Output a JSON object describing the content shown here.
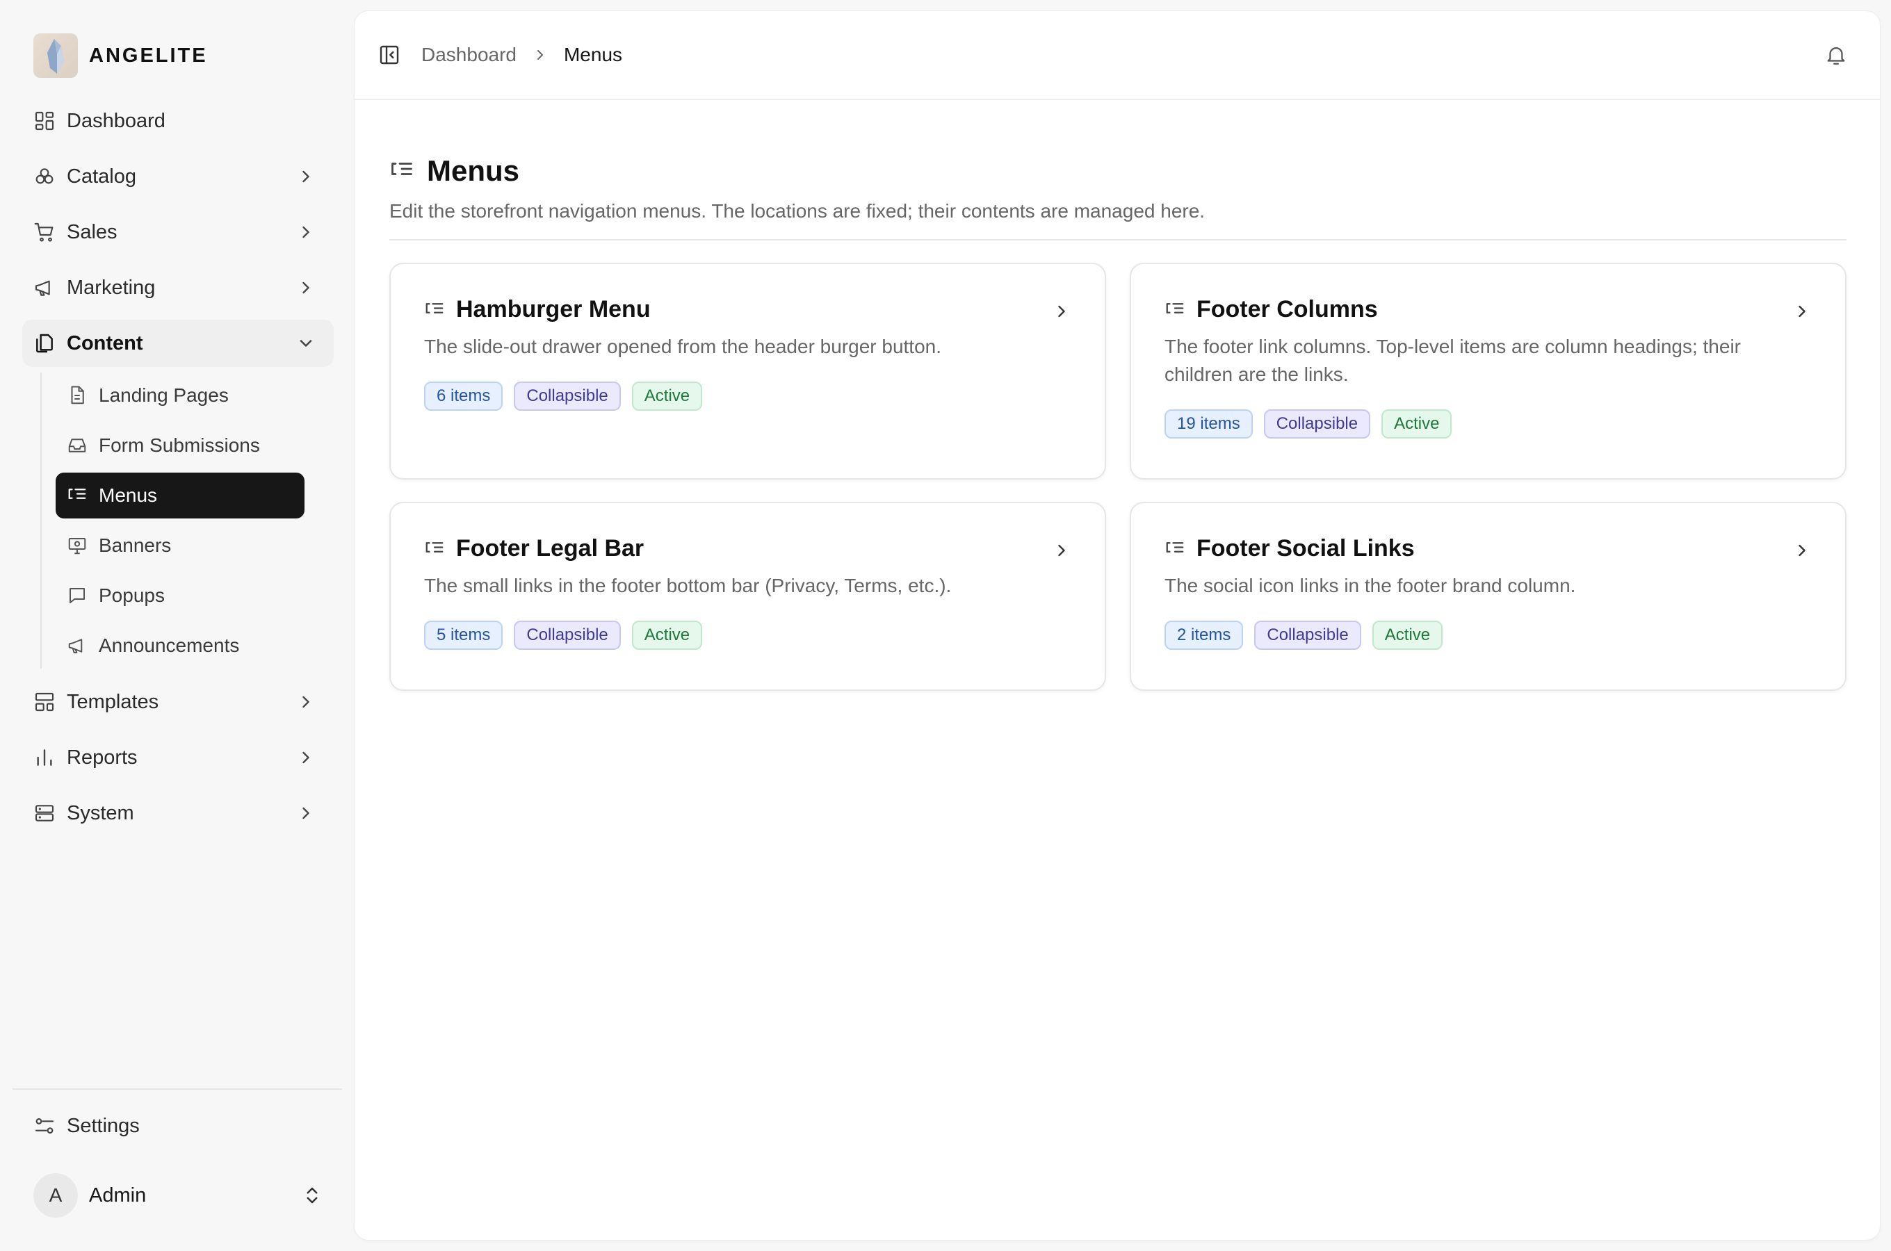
{
  "brand": {
    "name": "ANGELITE"
  },
  "sidebar": {
    "items": [
      {
        "key": "dashboard",
        "label": "Dashboard",
        "icon": "dashboard-icon"
      },
      {
        "key": "catalog",
        "label": "Catalog",
        "icon": "catalog-icon"
      },
      {
        "key": "sales",
        "label": "Sales",
        "icon": "cart-icon"
      },
      {
        "key": "marketing",
        "label": "Marketing",
        "icon": "megaphone-icon"
      },
      {
        "key": "content",
        "label": "Content",
        "icon": "pages-icon"
      },
      {
        "key": "templates",
        "label": "Templates",
        "icon": "layout-icon"
      },
      {
        "key": "reports",
        "label": "Reports",
        "icon": "bar-chart-icon"
      },
      {
        "key": "system",
        "label": "System",
        "icon": "server-icon"
      }
    ],
    "content_children": [
      {
        "label": "Landing Pages",
        "icon": "file-text-icon"
      },
      {
        "label": "Form Submissions",
        "icon": "inbox-icon"
      },
      {
        "label": "Menus",
        "icon": "list-tree-icon"
      },
      {
        "label": "Banners",
        "icon": "presentation-icon"
      },
      {
        "label": "Popups",
        "icon": "message-square-icon"
      },
      {
        "label": "Announcements",
        "icon": "megaphone-icon"
      }
    ],
    "settings_label": "Settings",
    "user": {
      "initial": "A",
      "name": "Admin"
    }
  },
  "breadcrumb": {
    "parent": "Dashboard",
    "current": "Menus"
  },
  "page": {
    "title": "Menus",
    "description": "Edit the storefront navigation menus. The locations are fixed; their contents are managed here."
  },
  "menus": [
    {
      "title": "Hamburger Menu",
      "description": "The slide-out drawer opened from the header burger button.",
      "items": "6 items",
      "mode": "Collapsible",
      "status": "Active"
    },
    {
      "title": "Footer Columns",
      "description": "The footer link columns. Top-level items are column headings; their children are the links.",
      "items": "19 items",
      "mode": "Collapsible",
      "status": "Active"
    },
    {
      "title": "Footer Legal Bar",
      "description": "The small links in the footer bottom bar (Privacy, Terms, etc.).",
      "items": "5 items",
      "mode": "Collapsible",
      "status": "Active"
    },
    {
      "title": "Footer Social Links",
      "description": "The social icon links in the footer brand column.",
      "items": "2 items",
      "mode": "Collapsible",
      "status": "Active"
    }
  ],
  "colors": {
    "active_nav_bg": "#171717",
    "badge_items": "#2553a6",
    "badge_collapsible": "#3f3a9a",
    "badge_active": "#1d7a3c"
  }
}
